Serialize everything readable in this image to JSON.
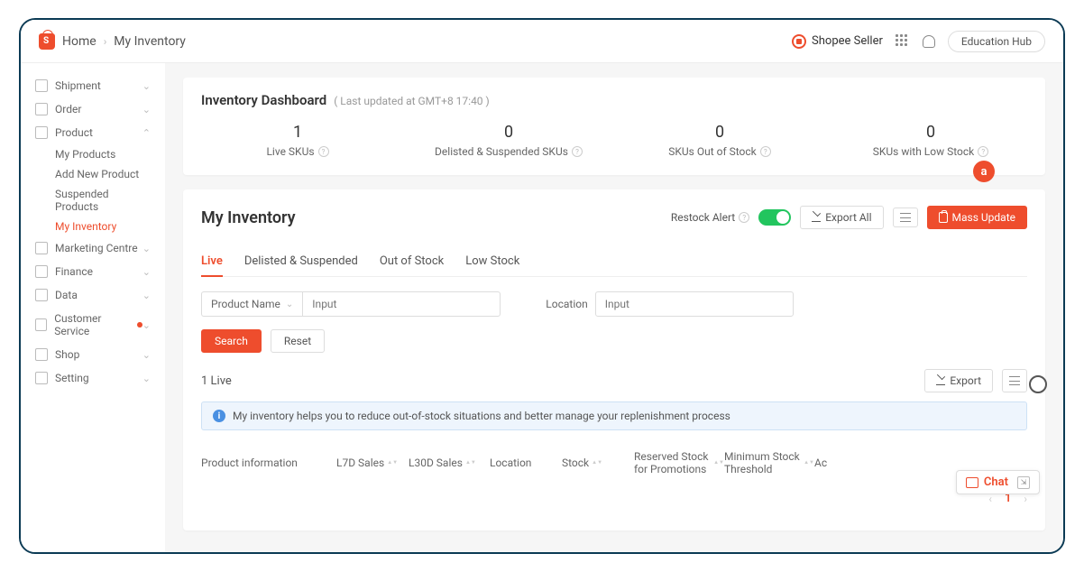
{
  "header": {
    "home": "Home",
    "page": "My Inventory",
    "seller_label": "Shopee Seller",
    "edu_hub": "Education Hub"
  },
  "sidebar": {
    "shipment": "Shipment",
    "order": "Order",
    "product": "Product",
    "product_subs": {
      "my_products": "My Products",
      "add_new": "Add New Product",
      "suspended": "Suspended Products",
      "my_inventory": "My Inventory"
    },
    "marketing": "Marketing Centre",
    "finance": "Finance",
    "data": "Data",
    "customer_service": "Customer Service",
    "shop": "Shop",
    "setting": "Setting"
  },
  "dashboard": {
    "title": "Inventory Dashboard",
    "updated": "( Last updated at GMT+8 17:40 )",
    "stats": [
      {
        "value": "1",
        "label": "Live SKUs"
      },
      {
        "value": "0",
        "label": "Delisted & Suspended SKUs"
      },
      {
        "value": "0",
        "label": "SKUs Out of Stock"
      },
      {
        "value": "0",
        "label": "SKUs with Low Stock"
      }
    ]
  },
  "inventory": {
    "title": "My Inventory",
    "restock_alert": "Restock Alert",
    "export_all": "Export All",
    "mass_update": "Mass Update",
    "tabs": {
      "live": "Live",
      "delisted": "Delisted & Suspended",
      "out_of_stock": "Out of Stock",
      "low_stock": "Low Stock"
    },
    "filter": {
      "product_name": "Product Name",
      "input_placeholder": "Input",
      "location": "Location"
    },
    "search": "Search",
    "reset": "Reset",
    "count": "1 Live",
    "export": "Export",
    "info": "My inventory helps you to reduce out-of-stock situations and better manage your replenishment process",
    "columns": {
      "product_info": "Product information",
      "l7d": "L7D Sales",
      "l30d": "L30D Sales",
      "location": "Location",
      "stock": "Stock",
      "reserved": "Reserved Stock for Promotions",
      "threshold": "Minimum Stock Threshold",
      "action": "Ac"
    },
    "page": "1"
  },
  "chat": {
    "label": "Chat"
  },
  "annotation": {
    "a": "a"
  }
}
